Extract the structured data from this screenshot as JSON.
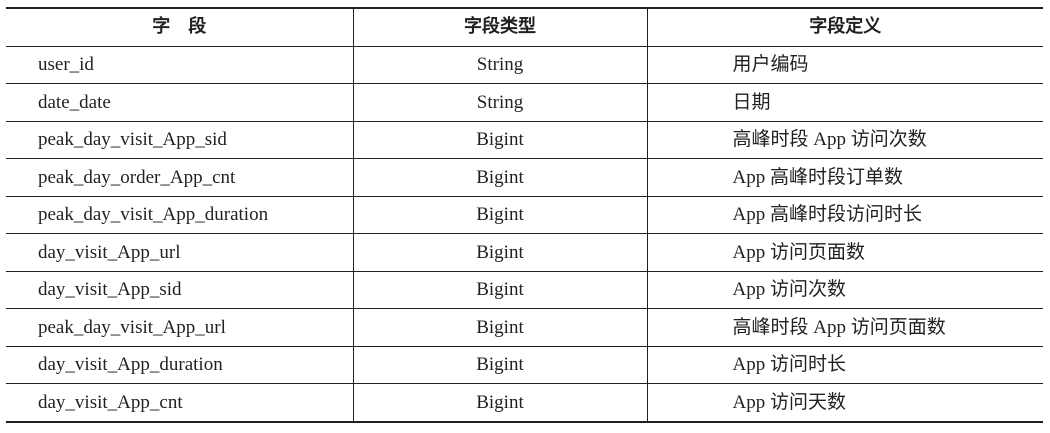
{
  "table": {
    "headers": [
      "字　段",
      "字段类型",
      "字段定义"
    ],
    "rows": [
      {
        "name": "user_id",
        "type": "String",
        "definition": "用户编码"
      },
      {
        "name": "date_date",
        "type": "String",
        "definition": "日期"
      },
      {
        "name": "peak_day_visit_App_sid",
        "type": "Bigint",
        "definition": "高峰时段 App 访问次数"
      },
      {
        "name": "peak_day_order_App_cnt",
        "type": "Bigint",
        "definition": "App 高峰时段订单数"
      },
      {
        "name": "peak_day_visit_App_duration",
        "type": "Bigint",
        "definition": "App 高峰时段访问时长"
      },
      {
        "name": "day_visit_App_url",
        "type": "Bigint",
        "definition": "App 访问页面数"
      },
      {
        "name": "day_visit_App_sid",
        "type": "Bigint",
        "definition": "App 访问次数"
      },
      {
        "name": "peak_day_visit_App_url",
        "type": "Bigint",
        "definition": "高峰时段 App 访问页面数"
      },
      {
        "name": "day_visit_App_duration",
        "type": "Bigint",
        "definition": "App 访问时长"
      },
      {
        "name": "day_visit_App_cnt",
        "type": "Bigint",
        "definition": "App 访问天数"
      }
    ]
  }
}
